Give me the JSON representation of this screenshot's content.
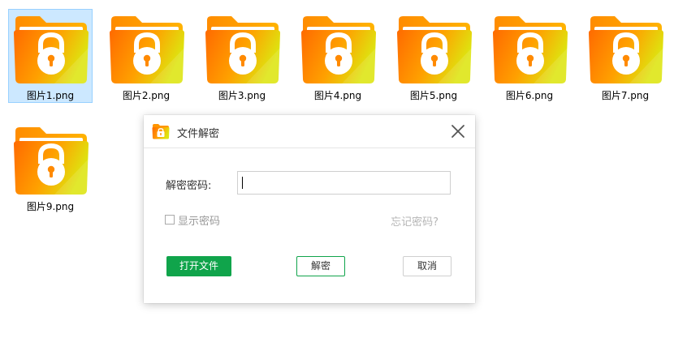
{
  "files": [
    {
      "name": "图片1.png",
      "selected": true
    },
    {
      "name": "图片2.png",
      "selected": false
    },
    {
      "name": "图片3.png",
      "selected": false
    },
    {
      "name": "图片4.png",
      "selected": false
    },
    {
      "name": "图片5.png",
      "selected": false
    },
    {
      "name": "图片6.png",
      "selected": false
    },
    {
      "name": "图片7.png",
      "selected": false
    },
    {
      "name": "图片9.png",
      "selected": false
    }
  ],
  "file_icon": "locked-folder-icon",
  "colors": {
    "folder_gradient_start": "#ff7a00",
    "folder_gradient_end": "#e4e00c",
    "selection_bg": "#cce8ff",
    "primary_green": "#10a44b"
  },
  "dialog": {
    "title": "文件解密",
    "password_label": "解密密码:",
    "password_value": "",
    "show_password_label": "显示密码",
    "show_password_checked": false,
    "forgot_password_link": "忘记密码?",
    "open_file_button": "打开文件",
    "decrypt_button": "解密",
    "cancel_button": "取消"
  }
}
